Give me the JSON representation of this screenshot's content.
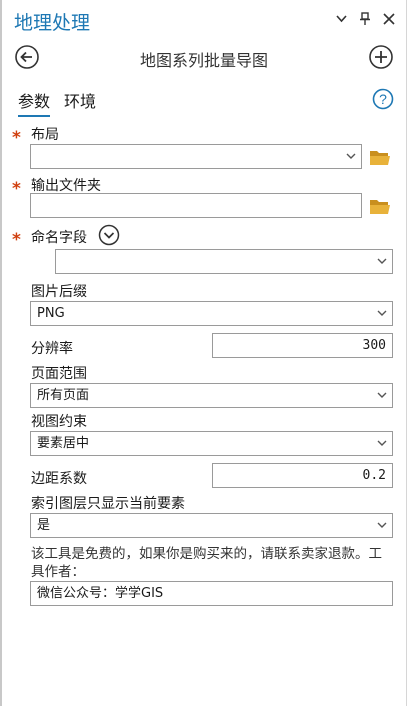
{
  "pane": {
    "title": "地理处理"
  },
  "tool": {
    "title": "地图系列批量导图"
  },
  "tabs": [
    {
      "label": "参数"
    },
    {
      "label": "环境"
    }
  ],
  "params": {
    "layout": {
      "label": "布局",
      "value": ""
    },
    "output_folder": {
      "label": "输出文件夹",
      "value": ""
    },
    "naming_field": {
      "label": "命名字段",
      "value": ""
    },
    "image_suffix": {
      "label": "图片后缀",
      "value": "PNG"
    },
    "resolution": {
      "label": "分辨率",
      "value": "300"
    },
    "page_range": {
      "label": "页面范围",
      "value": "所有页面"
    },
    "view_constraint": {
      "label": "视图约束",
      "value": "要素居中"
    },
    "margin_factor": {
      "label": "边距系数",
      "value": "0.2"
    },
    "index_only_current": {
      "label": "索引图层只显示当前要素",
      "value": "是"
    }
  },
  "note": {
    "text": "该工具是免费的，如果你是购买来的，请联系卖家退款。工具作者：",
    "author": "微信公众号：学学GIS"
  },
  "colors": {
    "accent": "#1e78b4",
    "required": "#d04010",
    "folder": "#e0a830"
  },
  "icons": [
    "chevron-down-icon",
    "pin-icon",
    "close-icon",
    "back-arrow-icon",
    "add-icon",
    "help-icon",
    "folder-icon",
    "expand-icon"
  ]
}
